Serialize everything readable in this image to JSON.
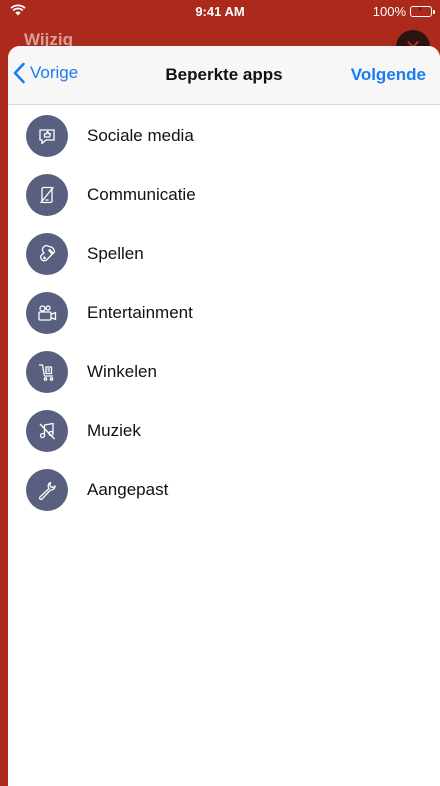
{
  "status_bar": {
    "time": "9:41 AM",
    "battery": "100%"
  },
  "background_screen": {
    "title": "Wijzig"
  },
  "nav": {
    "back_label": "Vorige",
    "title": "Beperkte apps",
    "next_label": "Volgende"
  },
  "categories": [
    {
      "label": "Sociale media",
      "icon": "social-media-icon"
    },
    {
      "label": "Communicatie",
      "icon": "communication-blocked-icon"
    },
    {
      "label": "Spellen",
      "icon": "game-controller-icon"
    },
    {
      "label": "Entertainment",
      "icon": "video-camera-icon"
    },
    {
      "label": "Winkelen",
      "icon": "shopping-cart-icon"
    },
    {
      "label": "Muziek",
      "icon": "music-blocked-icon"
    },
    {
      "label": "Aangepast",
      "icon": "wrench-icon"
    }
  ],
  "colors": {
    "accent": "#1a7cf2",
    "icon_bg": "#59607f",
    "header_bg": "#ab2a1c"
  }
}
